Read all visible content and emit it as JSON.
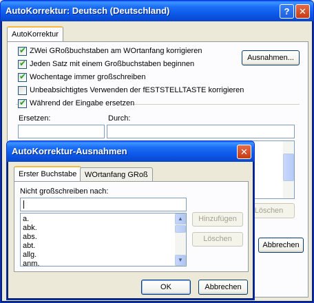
{
  "main_dialog": {
    "title": "AutoKorrektur: Deutsch (Deutschland)",
    "help_glyph": "?",
    "close_glyph": "✕",
    "tab_label": "AutoKorrektur",
    "options": [
      {
        "label": "ZWei GRoßbuchstaben am WOrtanfang korrigieren",
        "checked": true
      },
      {
        "label": "Jeden Satz mit einem Großbuchstaben beginnen",
        "checked": true
      },
      {
        "label": "Wochentage immer großschreiben",
        "checked": true
      },
      {
        "label": "Unbeabsichtigtes Verwenden der fESTSTELLTASTE korrigieren",
        "checked": false
      },
      {
        "label": "Während der Eingabe ersetzen",
        "checked": true
      }
    ],
    "exceptions_button": "Ausnahmen...",
    "replace_label": "Ersetzen:",
    "with_label": "Durch:",
    "delete_button_partial": "Löschen",
    "cancel_button": "Abbrechen"
  },
  "exceptions_dialog": {
    "title": "AutoKorrektur-Ausnahmen",
    "close_glyph": "✕",
    "tabs": [
      "Erster Buchstabe",
      "WOrtanfang GRoß"
    ],
    "list_label": "Nicht großschreiben nach:",
    "input_value": "",
    "items": [
      "a.",
      "abk.",
      "abs.",
      "abt.",
      "allg.",
      "anm."
    ],
    "add_button": "Hinzufügen",
    "delete_button": "Löschen",
    "ok_button": "OK",
    "cancel_button": "Abbrechen"
  },
  "colors": {
    "titlebar": "#0a5ef5",
    "dialog_bg": "#ece9d8",
    "check_mark": "#21a121",
    "tab_highlight": "#f6b83f"
  }
}
